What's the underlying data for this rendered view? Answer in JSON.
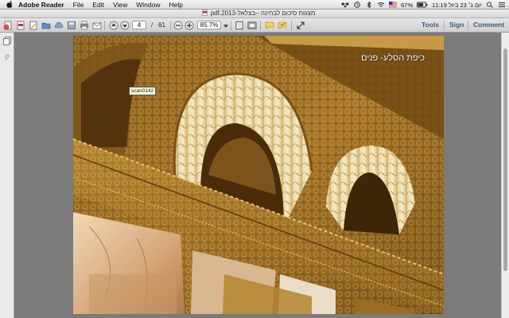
{
  "menubar": {
    "app": "Adobe Reader",
    "items": [
      "File",
      "Edit",
      "View",
      "Window",
      "Help"
    ],
    "status": {
      "battery": "67%",
      "datetime": "יום ג׳ 23 ביול 11:19"
    }
  },
  "window": {
    "title": "מצגות סיכום לבחינה –בצלאל-2013.pdf"
  },
  "toolbar": {
    "page_current": "4",
    "page_sep": "/",
    "page_total": "61",
    "zoom": "85.7%",
    "links": [
      "Tools",
      "Sign",
      "Comment"
    ]
  },
  "page": {
    "heading": "כיפת הסלע- פנים",
    "sticky_label": "scan0142"
  },
  "colors": {
    "link": "#3c5a80",
    "gold": "#b8882e",
    "dark_gold": "#6e4a16"
  }
}
